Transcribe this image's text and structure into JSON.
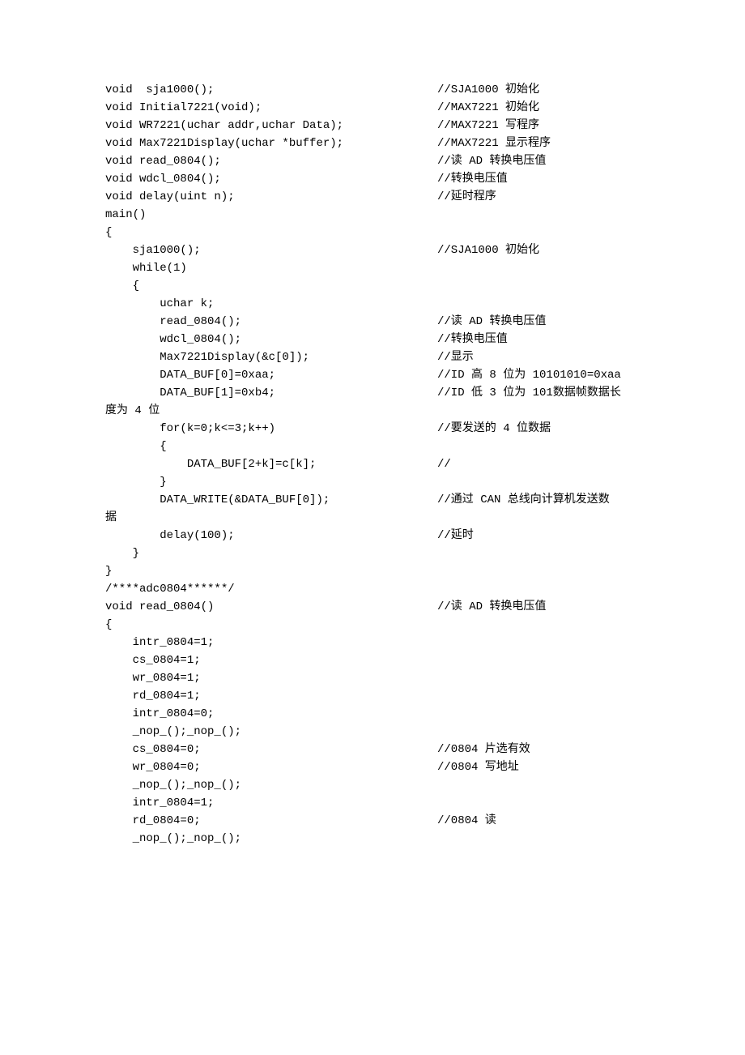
{
  "lines": [
    {
      "code": "void  sja1000();",
      "comment": "//SJA1000 初始化"
    },
    {
      "code": "void Initial7221(void);",
      "comment": "//MAX7221 初始化"
    },
    {
      "code": "void WR7221(uchar addr,uchar Data);",
      "comment": "//MAX7221 写程序"
    },
    {
      "code": "void Max7221Display(uchar *buffer);",
      "comment": "//MAX7221 显示程序"
    },
    {
      "code": "void read_0804();",
      "comment": "//读 AD 转换电压值"
    },
    {
      "code": "void wdcl_0804();",
      "comment": "//转换电压值"
    },
    {
      "code": "void delay(uint n);",
      "comment": "//延时程序"
    },
    {
      "code": "",
      "comment": ""
    },
    {
      "code": "main()",
      "comment": ""
    },
    {
      "code": "{",
      "comment": ""
    },
    {
      "code": "    sja1000();",
      "comment": "//SJA1000 初始化"
    },
    {
      "code": "    while(1)",
      "comment": ""
    },
    {
      "code": "    {",
      "comment": ""
    },
    {
      "code": "        uchar k;",
      "comment": ""
    },
    {
      "code": "        read_0804();",
      "comment": "//读 AD 转换电压值"
    },
    {
      "code": "        wdcl_0804();",
      "comment": "//转换电压值"
    },
    {
      "code": "        Max7221Display(&c[0]);",
      "comment": "//显示"
    },
    {
      "code": "        DATA_BUF[0]=0xaa;",
      "comment": "//ID 高 8 位为 10101010=0xaa"
    },
    {
      "code": "        DATA_BUF[1]=0xb4;",
      "comment": "//ID 低 3 位为 101数据帧数据长"
    },
    {
      "code": "度为 4 位",
      "comment": ""
    },
    {
      "code": "        for(k=0;k<=3;k++)",
      "comment": "//要发送的 4 位数据"
    },
    {
      "code": "        {",
      "comment": ""
    },
    {
      "code": "            DATA_BUF[2+k]=c[k];",
      "comment": "//"
    },
    {
      "code": "        }",
      "comment": ""
    },
    {
      "code": "        DATA_WRITE(&DATA_BUF[0]);",
      "comment": "//通过 CAN 总线向计算机发送数"
    },
    {
      "code": "据",
      "comment": ""
    },
    {
      "code": "        delay(100);",
      "comment": "//延时"
    },
    {
      "code": "    }",
      "comment": ""
    },
    {
      "code": "}",
      "comment": ""
    },
    {
      "code": "/****adc0804******/",
      "comment": ""
    },
    {
      "code": "void read_0804()",
      "comment": "//读 AD 转换电压值"
    },
    {
      "code": "{",
      "comment": ""
    },
    {
      "code": "    intr_0804=1;",
      "comment": ""
    },
    {
      "code": "    cs_0804=1;",
      "comment": ""
    },
    {
      "code": "    wr_0804=1;",
      "comment": ""
    },
    {
      "code": "    rd_0804=1;",
      "comment": ""
    },
    {
      "code": "    intr_0804=0;",
      "comment": ""
    },
    {
      "code": "    _nop_();_nop_();",
      "comment": ""
    },
    {
      "code": "    cs_0804=0;",
      "comment": "//0804 片选有效"
    },
    {
      "code": "    wr_0804=0;",
      "comment": "//0804 写地址"
    },
    {
      "code": "    _nop_();_nop_();",
      "comment": ""
    },
    {
      "code": "    intr_0804=1;",
      "comment": ""
    },
    {
      "code": "    rd_0804=0;",
      "comment": "//0804 读"
    },
    {
      "code": "    _nop_();_nop_();",
      "comment": ""
    }
  ]
}
